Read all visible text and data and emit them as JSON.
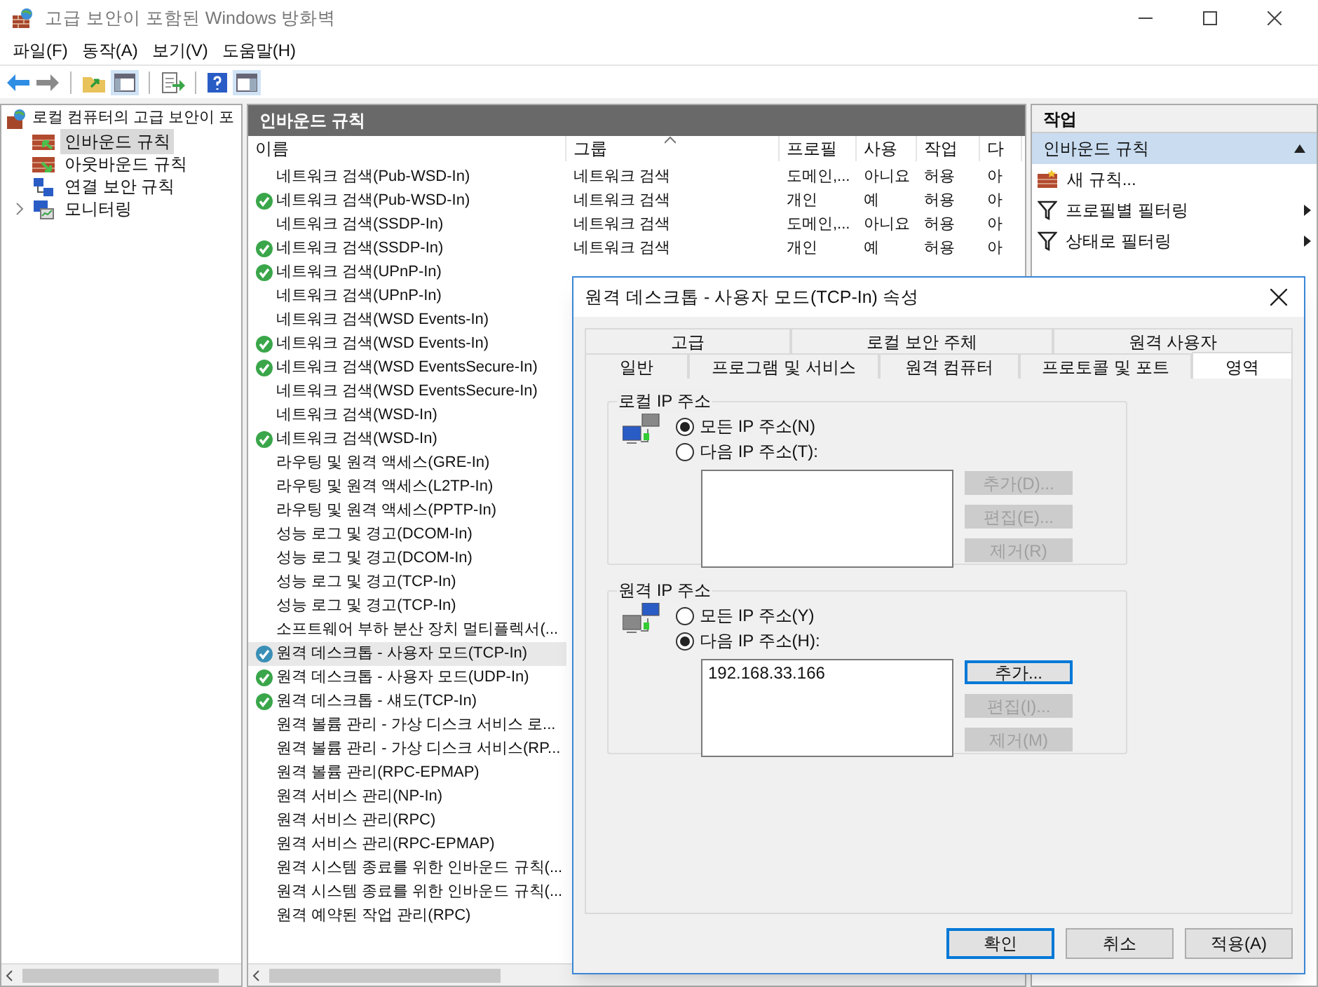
{
  "window": {
    "title": "고급 보안이 포함된 Windows 방화벽"
  },
  "menu": [
    "파일(F)",
    "동작(A)",
    "보기(V)",
    "도움말(H)"
  ],
  "tree": {
    "root": "로컬 컴퓨터의 고급 보안이 포",
    "children": [
      {
        "label": "인바운드 규칙",
        "kind": "inbound",
        "selected": true,
        "expandable": false
      },
      {
        "label": "아웃바운드 규칙",
        "kind": "outbound",
        "selected": false,
        "expandable": false
      },
      {
        "label": "연결 보안 규칙",
        "kind": "connection",
        "selected": false,
        "expandable": false
      },
      {
        "label": "모니터링",
        "kind": "monitor",
        "selected": false,
        "expandable": true
      }
    ]
  },
  "table": {
    "title": "인바운드 규칙",
    "columns": [
      {
        "label": "이름",
        "sorted": false
      },
      {
        "label": "그룹",
        "sorted": true
      },
      {
        "label": "프로필",
        "sorted": false
      },
      {
        "label": "사용",
        "sorted": false
      },
      {
        "label": "작업",
        "sorted": false
      },
      {
        "label": "다",
        "sorted": false
      }
    ],
    "rows": [
      {
        "name": "네트워크 검색(Pub-WSD-In)",
        "enabled": false,
        "selected": false,
        "cells": [
          "네트워크 검색",
          "도메인,...",
          "아니요",
          "허용",
          "아"
        ]
      },
      {
        "name": "네트워크 검색(Pub-WSD-In)",
        "enabled": true,
        "selected": false,
        "cells": [
          "네트워크 검색",
          "개인",
          "예",
          "허용",
          "아"
        ]
      },
      {
        "name": "네트워크 검색(SSDP-In)",
        "enabled": false,
        "selected": false,
        "cells": [
          "네트워크 검색",
          "도메인,...",
          "아니요",
          "허용",
          "아"
        ]
      },
      {
        "name": "네트워크 검색(SSDP-In)",
        "enabled": true,
        "selected": false,
        "cells": [
          "네트워크 검색",
          "개인",
          "예",
          "허용",
          "아"
        ]
      },
      {
        "name": "네트워크 검색(UPnP-In)",
        "enabled": true,
        "selected": false
      },
      {
        "name": "네트워크 검색(UPnP-In)",
        "enabled": false,
        "selected": false
      },
      {
        "name": "네트워크 검색(WSD Events-In)",
        "enabled": false,
        "selected": false
      },
      {
        "name": "네트워크 검색(WSD Events-In)",
        "enabled": true,
        "selected": false
      },
      {
        "name": "네트워크 검색(WSD EventsSecure-In)",
        "enabled": true,
        "selected": false
      },
      {
        "name": "네트워크 검색(WSD EventsSecure-In)",
        "enabled": false,
        "selected": false
      },
      {
        "name": "네트워크 검색(WSD-In)",
        "enabled": false,
        "selected": false
      },
      {
        "name": "네트워크 검색(WSD-In)",
        "enabled": true,
        "selected": false
      },
      {
        "name": "라우팅 및 원격 액세스(GRE-In)",
        "enabled": false,
        "selected": false
      },
      {
        "name": "라우팅 및 원격 액세스(L2TP-In)",
        "enabled": false,
        "selected": false
      },
      {
        "name": "라우팅 및 원격 액세스(PPTP-In)",
        "enabled": false,
        "selected": false
      },
      {
        "name": "성능 로그 및 경고(DCOM-In)",
        "enabled": false,
        "selected": false
      },
      {
        "name": "성능 로그 및 경고(DCOM-In)",
        "enabled": false,
        "selected": false
      },
      {
        "name": "성능 로그 및 경고(TCP-In)",
        "enabled": false,
        "selected": false
      },
      {
        "name": "성능 로그 및 경고(TCP-In)",
        "enabled": false,
        "selected": false
      },
      {
        "name": "소프트웨어 부하 분산 장치 멀티플렉서(...",
        "enabled": false,
        "selected": false
      },
      {
        "name": "원격 데스크톱 - 사용자 모드(TCP-In)",
        "enabled": true,
        "selected": true
      },
      {
        "name": "원격 데스크톱 - 사용자 모드(UDP-In)",
        "enabled": true,
        "selected": false
      },
      {
        "name": "원격 데스크톱 - 섀도(TCP-In)",
        "enabled": true,
        "selected": false
      },
      {
        "name": "원격 볼륨 관리 - 가상 디스크 서비스 로...",
        "enabled": false,
        "selected": false
      },
      {
        "name": "원격 볼륨 관리 - 가상 디스크 서비스(RP...",
        "enabled": false,
        "selected": false
      },
      {
        "name": "원격 볼륨 관리(RPC-EPMAP)",
        "enabled": false,
        "selected": false
      },
      {
        "name": "원격 서비스 관리(NP-In)",
        "enabled": false,
        "selected": false
      },
      {
        "name": "원격 서비스 관리(RPC)",
        "enabled": false,
        "selected": false
      },
      {
        "name": "원격 서비스 관리(RPC-EPMAP)",
        "enabled": false,
        "selected": false
      },
      {
        "name": "원격 시스템 종료를 위한 인바운드 규칙(...",
        "enabled": false,
        "selected": false
      },
      {
        "name": "원격 시스템 종료를 위한 인바운드 규칙(...",
        "enabled": false,
        "selected": false
      },
      {
        "name": "원격 예약된 작업 관리(RPC)",
        "enabled": false,
        "selected": false
      }
    ]
  },
  "actions": {
    "title": "작업",
    "section": "인바운드 규칙",
    "items": [
      {
        "label": "새 규칙...",
        "kind": "new",
        "submenu": false
      },
      {
        "label": "프로필별 필터링",
        "kind": "filter",
        "submenu": true
      },
      {
        "label": "상태로 필터링",
        "kind": "filter",
        "submenu": true
      }
    ]
  },
  "dialog": {
    "title": "원격 데스크톱 - 사용자 모드(TCP-In) 속성",
    "tab_rows": [
      [
        {
          "label": "고급",
          "selected": false
        },
        {
          "label": "로컬 보안 주체",
          "selected": false
        },
        {
          "label": "원격 사용자",
          "selected": false
        }
      ],
      [
        {
          "label": "일반",
          "selected": false
        },
        {
          "label": "프로그램 및 서비스",
          "selected": false
        },
        {
          "label": "원격 컴퓨터",
          "selected": false
        },
        {
          "label": "프로토콜 및 포트",
          "selected": false
        },
        {
          "label": "영역",
          "selected": true
        }
      ]
    ],
    "groups": [
      {
        "title": "로컬 IP 주소",
        "options": [
          {
            "label": "모든 IP 주소(N)",
            "selected": true
          },
          {
            "label": "다음 IP 주소(T):",
            "selected": false
          }
        ],
        "buttons": [
          {
            "label": "추가(D)...",
            "disabled": true,
            "focused": false
          },
          {
            "label": "편집(E)...",
            "disabled": true,
            "focused": false
          },
          {
            "label": "제거(R)",
            "disabled": true,
            "focused": false
          }
        ]
      },
      {
        "title": "원격 IP 주소",
        "options": [
          {
            "label": "모든 IP 주소(Y)",
            "selected": false
          },
          {
            "label": "다음 IP 주소(H):",
            "selected": true
          }
        ],
        "addresses": [
          "192.168.33.166"
        ],
        "buttons": [
          {
            "label": "추가...",
            "disabled": false,
            "focused": true
          },
          {
            "label": "편집(I)...",
            "disabled": true,
            "focused": false
          },
          {
            "label": "제거(M)",
            "disabled": true,
            "focused": false
          }
        ]
      }
    ],
    "buttons": [
      {
        "label": "확인",
        "default": true
      },
      {
        "label": "취소",
        "default": false
      },
      {
        "label": "적용(A)",
        "default": false
      }
    ]
  }
}
